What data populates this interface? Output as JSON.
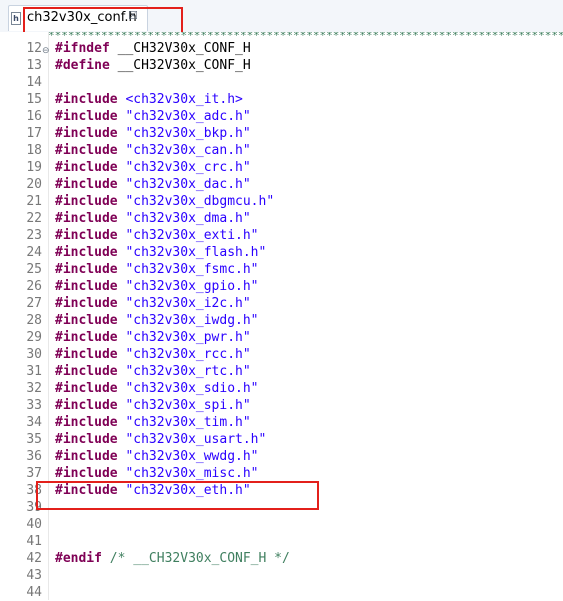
{
  "tab": {
    "icon_letter": "h",
    "filename": "ch32v30x_conf.h",
    "close_glyph": "☒"
  },
  "header_stars": "*************************************************************************************************",
  "lines": [
    {
      "num": "12",
      "text": "#ifndef __CH32V30x_CONF_H"
    },
    {
      "num": "13",
      "text": "#define __CH32V30x_CONF_H"
    },
    {
      "num": "14",
      "text": ""
    },
    {
      "num": "15",
      "text": "#include <ch32v30x_it.h>"
    },
    {
      "num": "16",
      "text": "#include \"ch32v30x_adc.h\""
    },
    {
      "num": "17",
      "text": "#include \"ch32v30x_bkp.h\""
    },
    {
      "num": "18",
      "text": "#include \"ch32v30x_can.h\""
    },
    {
      "num": "19",
      "text": "#include \"ch32v30x_crc.h\""
    },
    {
      "num": "20",
      "text": "#include \"ch32v30x_dac.h\""
    },
    {
      "num": "21",
      "text": "#include \"ch32v30x_dbgmcu.h\""
    },
    {
      "num": "22",
      "text": "#include \"ch32v30x_dma.h\""
    },
    {
      "num": "23",
      "text": "#include \"ch32v30x_exti.h\""
    },
    {
      "num": "24",
      "text": "#include \"ch32v30x_flash.h\""
    },
    {
      "num": "25",
      "text": "#include \"ch32v30x_fsmc.h\""
    },
    {
      "num": "26",
      "text": "#include \"ch32v30x_gpio.h\""
    },
    {
      "num": "27",
      "text": "#include \"ch32v30x_i2c.h\""
    },
    {
      "num": "28",
      "text": "#include \"ch32v30x_iwdg.h\""
    },
    {
      "num": "29",
      "text": "#include \"ch32v30x_pwr.h\""
    },
    {
      "num": "30",
      "text": "#include \"ch32v30x_rcc.h\""
    },
    {
      "num": "31",
      "text": "#include \"ch32v30x_rtc.h\""
    },
    {
      "num": "32",
      "text": "#include \"ch32v30x_sdio.h\""
    },
    {
      "num": "33",
      "text": "#include \"ch32v30x_spi.h\""
    },
    {
      "num": "34",
      "text": "#include \"ch32v30x_tim.h\""
    },
    {
      "num": "35",
      "text": "#include \"ch32v30x_usart.h\""
    },
    {
      "num": "36",
      "text": "#include \"ch32v30x_wwdg.h\""
    },
    {
      "num": "37",
      "text": "#include \"ch32v30x_misc.h\""
    },
    {
      "num": "38",
      "text": "#include \"ch32v30x_eth.h\""
    },
    {
      "num": "39",
      "text": ""
    },
    {
      "num": "40",
      "text": ""
    },
    {
      "num": "41",
      "text": ""
    },
    {
      "num": "42",
      "text": "#endif /* __CH32V30x_CONF_H */"
    },
    {
      "num": "43",
      "text": ""
    },
    {
      "num": "44",
      "text": ""
    }
  ],
  "colors": {
    "keyword": "#7f0055",
    "string": "#2a00ff",
    "comment": "#3f7f5f",
    "line_number": "#787878",
    "highlight_box": "#e3201b"
  }
}
